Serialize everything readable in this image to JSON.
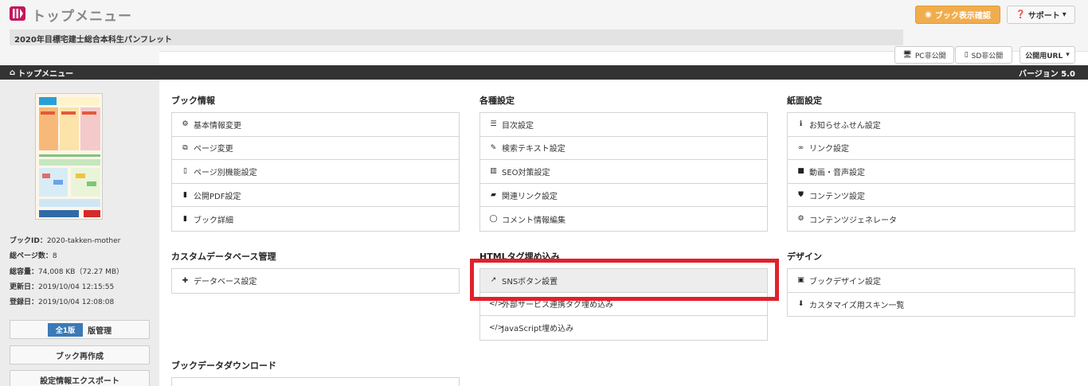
{
  "header": {
    "app_title": "トップメニュー",
    "book_title": "2020年目標宅建士総合本科生パンフレット",
    "preview_button": "ブック表示確認",
    "support_button": "サポート",
    "pc_private": "PC非公開",
    "sd_private": "SD非公開",
    "public_url": "公開用URL",
    "accent_color": "#f0ad4e"
  },
  "nav": {
    "home_label": "トップメニュー",
    "version": "バージョン 5.0"
  },
  "sidebar": {
    "book_id_label": "ブックID：",
    "book_id": "2020-takken-mother",
    "pages_label": "総ページ数：",
    "pages": "8",
    "size_label": "総容量：",
    "size": "74,008 KB（72.27 MB）",
    "updated_label": "更新日：",
    "updated": "2019/10/04 12:15:55",
    "registered_label": "登録日：",
    "registered": "2019/10/04 12:08:08",
    "version_badge": "全1版",
    "version_manage": "版管理",
    "rebuild_button": "ブック再作成",
    "export_button": "設定情報エクスポート"
  },
  "sections": {
    "book_info": {
      "title": "ブック情報",
      "items": [
        {
          "label": "基本情報変更",
          "icon": "gear-icon"
        },
        {
          "label": "ページ変更",
          "icon": "copy-icon"
        },
        {
          "label": "ページ別機能設定",
          "icon": "file-icon"
        },
        {
          "label": "公開PDF設定",
          "icon": "file-icon"
        },
        {
          "label": "ブック詳細",
          "icon": "file-icon"
        }
      ]
    },
    "settings": {
      "title": "各種設定",
      "items": [
        {
          "label": "目次設定",
          "icon": "list-icon"
        },
        {
          "label": "検索テキスト設定",
          "icon": "edit-icon"
        },
        {
          "label": "SEO対策設定",
          "icon": "chart-icon"
        },
        {
          "label": "関連リンク設定",
          "icon": "book-icon"
        },
        {
          "label": "コメント情報編集",
          "icon": "comment-icon"
        }
      ]
    },
    "paper": {
      "title": "紙面設定",
      "items": [
        {
          "label": "お知らせふせん設定",
          "icon": "info-icon"
        },
        {
          "label": "リンク設定",
          "icon": "link-icon"
        },
        {
          "label": "動画・音声設定",
          "icon": "video-icon"
        },
        {
          "label": "コンテンツ設定",
          "icon": "html5-icon"
        },
        {
          "label": "コンテンツジェネレータ",
          "icon": "cogs-icon"
        }
      ]
    },
    "custom_db": {
      "title": "カスタムデータベース管理",
      "items": [
        {
          "label": "データベース設定",
          "icon": "puzzle-icon"
        }
      ]
    },
    "html_tag": {
      "title": "HTMLタグ埋め込み",
      "items": [
        {
          "label": "SNSボタン設置",
          "icon": "share-icon"
        },
        {
          "label": "外部サービス連携タグ埋め込み",
          "icon": "code-icon"
        },
        {
          "label": "JavaScript埋め込み",
          "icon": "code-icon"
        }
      ]
    },
    "design": {
      "title": "デザイン",
      "items": [
        {
          "label": "ブックデザイン設定",
          "icon": "image-icon"
        },
        {
          "label": "カスタマイズ用スキン一覧",
          "icon": "download-icon"
        }
      ]
    },
    "download": {
      "title": "ブックデータダウンロード"
    }
  }
}
